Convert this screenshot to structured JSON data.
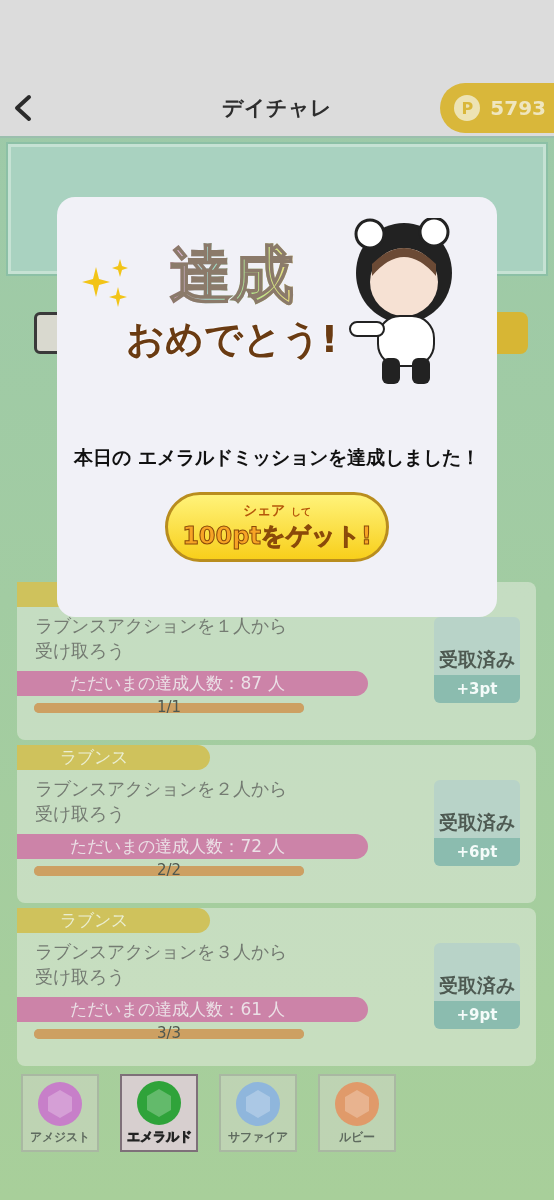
{
  "header": {
    "title": "デイチャレ",
    "points_symbol": "P",
    "points": "5793"
  },
  "modal": {
    "headline": "達成",
    "subheadline": "おめでとう!",
    "message": "本日の エメラルドミッションを達成しました！",
    "share_label": "シェア",
    "share_suffix": "して",
    "share_main": "100ptをゲット!"
  },
  "missions": [
    {
      "title": "ラブンスアクションを１人から受け取ろう",
      "count": "ただいまの達成人数：87 人",
      "progress": "1/1",
      "level": 1,
      "claim": "受取済み",
      "reward": "+3pt",
      "claimed": true
    },
    {
      "tag": "ラブンス",
      "title": "ラブンスアクションを２人から受け取ろう",
      "count": "ただいまの達成人数：72 人",
      "progress": "2/2",
      "level": 1,
      "claim": "受取済み",
      "reward": "+6pt",
      "claimed": true
    },
    {
      "tag": "ラブンス",
      "title": "ラブンスアクションを３人から受け取ろう",
      "count": "ただいまの達成人数：61 人",
      "progress": "3/3",
      "level": 1,
      "claim": "受取済み",
      "reward": "+9pt",
      "claimed": true
    }
  ],
  "gem_tabs": [
    {
      "label": "アメジスト",
      "color": "#c77fc9",
      "selected": false
    },
    {
      "label": "エメラルド",
      "color": "#2fa33a",
      "selected": true
    },
    {
      "label": "サファイア",
      "color": "#8fb6dc",
      "selected": false
    },
    {
      "label": "ルビー",
      "color": "#e09a6a",
      "selected": false
    }
  ]
}
